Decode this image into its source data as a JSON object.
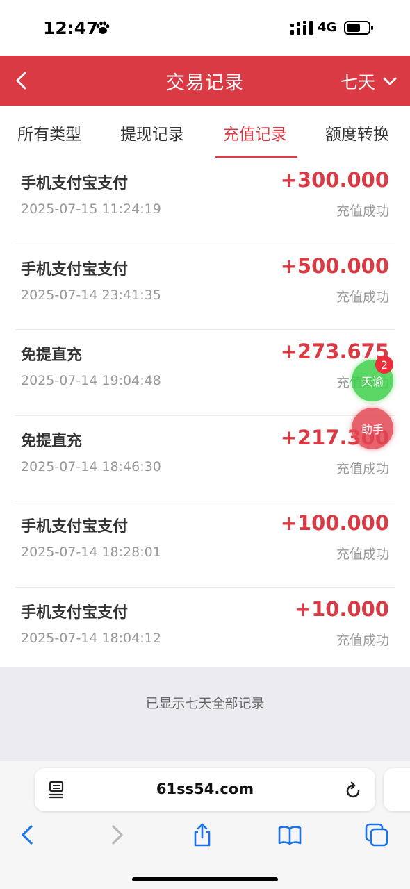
{
  "status_bar": {
    "time": "12:47",
    "network": "4G"
  },
  "header": {
    "title": "交易记录",
    "period": "七天"
  },
  "tabs": [
    {
      "label": "所有类型",
      "active": false
    },
    {
      "label": "提现记录",
      "active": false
    },
    {
      "label": "充值记录",
      "active": true
    },
    {
      "label": "额度转换",
      "active": false
    }
  ],
  "records": [
    {
      "name": "手机支付宝支付",
      "time": "2025-07-15 11:24:19",
      "amount": "+300.000",
      "status": "充值成功"
    },
    {
      "name": "手机支付宝支付",
      "time": "2025-07-14 23:41:35",
      "amount": "+500.000",
      "status": "充值成功"
    },
    {
      "name": "免提直充",
      "time": "2025-07-14 19:04:48",
      "amount": "+273.675",
      "status": "充值成功"
    },
    {
      "name": "免提直充",
      "time": "2025-07-14 18:46:30",
      "amount": "+217.300",
      "status": "充值成功"
    },
    {
      "name": "手机支付宝支付",
      "time": "2025-07-14 18:28:01",
      "amount": "+100.000",
      "status": "充值成功"
    },
    {
      "name": "手机支付宝支付",
      "time": "2025-07-14 18:04:12",
      "amount": "+10.000",
      "status": "充值成功"
    }
  ],
  "list_footer": "已显示七天全部记录",
  "floating": {
    "chat_label": "天谕",
    "chat_badge": "2",
    "help_label": "助手"
  },
  "browser": {
    "url": "61ss54.com"
  },
  "colors": {
    "accent": "#d93a43",
    "browser_link": "#1a73e8",
    "chat_float": "#3ed04b"
  }
}
